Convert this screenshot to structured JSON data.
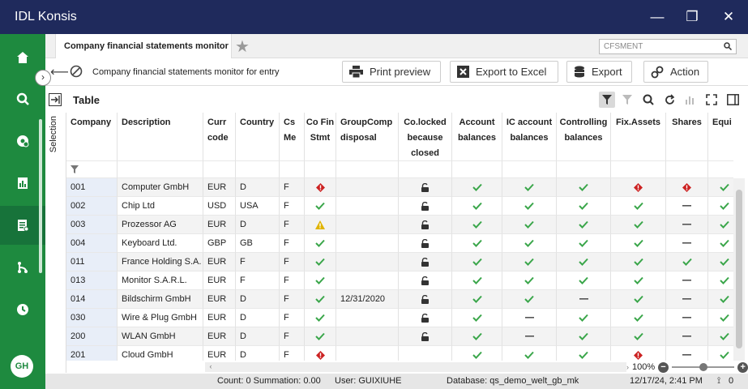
{
  "app": {
    "title": "IDL Konsis"
  },
  "window": {
    "minimize": "—",
    "maximize": "❐",
    "close": "✕"
  },
  "sidebar": {
    "items": [
      {
        "name": "home-icon"
      },
      {
        "name": "search-icon"
      },
      {
        "name": "settings-icon"
      },
      {
        "name": "report-icon"
      },
      {
        "name": "monitor-icon"
      },
      {
        "name": "workflow-icon"
      },
      {
        "name": "clock-icon"
      }
    ],
    "collapse": "›",
    "avatar": "GH"
  },
  "tabs": {
    "active": "Company financial statements monitor for",
    "search_placeholder": "CFSMENT"
  },
  "toolbar": {
    "title": "Company financial statements monitor for entry",
    "print": "Print preview",
    "excel": "Export to Excel",
    "export": "Export",
    "action": "Action"
  },
  "table": {
    "title": "Table",
    "selection_label": "Selection",
    "columns": [
      "Company",
      "Description",
      "Curr code",
      "Country",
      "Cs Me",
      "Co Fin Stmt",
      "GroupComp disposal",
      "Co.locked because closed",
      "Account balances",
      "IC account balances",
      "Controlling balances",
      "Fix.Assets",
      "Shares",
      "Equi"
    ],
    "rows": [
      {
        "company": "001",
        "description": "Computer GmbH",
        "curr": "EUR",
        "country": "D",
        "csme": "F",
        "cofin": "error",
        "disposal": "",
        "locked": "lock",
        "acc": "check",
        "ic": "check",
        "ctrl": "check",
        "fix": "error",
        "shares": "error",
        "equi": "check"
      },
      {
        "company": "002",
        "description": "Chip Ltd",
        "curr": "USD",
        "country": "USA",
        "csme": "F",
        "cofin": "check",
        "disposal": "",
        "locked": "lock",
        "acc": "check",
        "ic": "check",
        "ctrl": "check",
        "fix": "check",
        "shares": "dash",
        "equi": "check"
      },
      {
        "company": "003",
        "description": "Prozessor AG",
        "curr": "EUR",
        "country": "D",
        "csme": "F",
        "cofin": "warn",
        "disposal": "",
        "locked": "lock",
        "acc": "check",
        "ic": "check",
        "ctrl": "check",
        "fix": "check",
        "shares": "dash",
        "equi": "check"
      },
      {
        "company": "004",
        "description": "Keyboard Ltd.",
        "curr": "GBP",
        "country": "GB",
        "csme": "F",
        "cofin": "check",
        "disposal": "",
        "locked": "lock",
        "acc": "check",
        "ic": "check",
        "ctrl": "check",
        "fix": "check",
        "shares": "dash",
        "equi": "check"
      },
      {
        "company": "011",
        "description": "France Holding S.A.",
        "curr": "EUR",
        "country": "F",
        "csme": "F",
        "cofin": "check",
        "disposal": "",
        "locked": "lock",
        "acc": "check",
        "ic": "check",
        "ctrl": "check",
        "fix": "check",
        "shares": "check",
        "equi": "check"
      },
      {
        "company": "013",
        "description": "Monitor S.A.R.L.",
        "curr": "EUR",
        "country": "F",
        "csme": "F",
        "cofin": "check",
        "disposal": "",
        "locked": "lock",
        "acc": "check",
        "ic": "check",
        "ctrl": "check",
        "fix": "check",
        "shares": "dash",
        "equi": "check"
      },
      {
        "company": "014",
        "description": "Bildschirm GmbH",
        "curr": "EUR",
        "country": "D",
        "csme": "F",
        "cofin": "check",
        "disposal": "12/31/2020",
        "locked": "lock",
        "acc": "check",
        "ic": "check",
        "ctrl": "dash",
        "fix": "check",
        "shares": "dash",
        "equi": "check"
      },
      {
        "company": "030",
        "description": "Wire & Plug GmbH",
        "curr": "EUR",
        "country": "D",
        "csme": "F",
        "cofin": "check",
        "disposal": "",
        "locked": "lock",
        "acc": "check",
        "ic": "dash",
        "ctrl": "check",
        "fix": "check",
        "shares": "dash",
        "equi": "check"
      },
      {
        "company": "200",
        "description": "WLAN GmbH",
        "curr": "EUR",
        "country": "D",
        "csme": "F",
        "cofin": "check",
        "disposal": "",
        "locked": "lock",
        "acc": "check",
        "ic": "dash",
        "ctrl": "check",
        "fix": "check",
        "shares": "dash",
        "equi": "check"
      },
      {
        "company": "201",
        "description": "Cloud GmbH",
        "curr": "EUR",
        "country": "D",
        "csme": "F",
        "cofin": "error",
        "disposal": "",
        "locked": "",
        "acc": "check",
        "ic": "check",
        "ctrl": "check",
        "fix": "error",
        "shares": "dash",
        "equi": "check"
      }
    ]
  },
  "zoom": "100%",
  "status": {
    "count": "Count: 0 Summation: 0.00",
    "user": "User: GUIXIUHE",
    "database": "Database: qs_demo_welt_gb_mk",
    "datetime": "12/17/24, 2:41 PM",
    "feed": "0"
  },
  "colors": {
    "titlebar": "#1f2a5c",
    "sidebar": "#1e8a3f",
    "check": "#3aa64a",
    "error": "#cc2222",
    "warn": "#e0b400"
  }
}
